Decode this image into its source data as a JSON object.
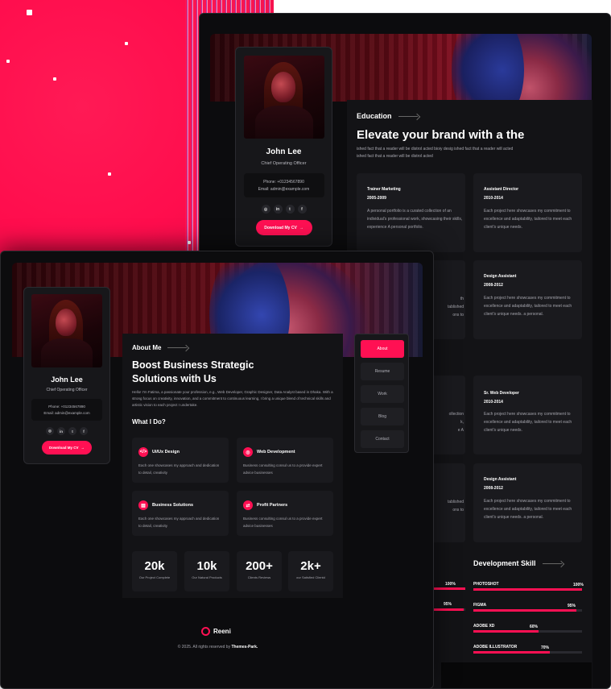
{
  "colors": {
    "accent": "#ff1053",
    "background": "#0c0c0e",
    "card": "#1a1a1e",
    "pink_bg": "#ff1a55"
  },
  "profile": {
    "name": "John Lee",
    "role": "Chief Operating Officer",
    "phone": "Phone: +01234567890",
    "email": "Email: admin@example.com",
    "socials": [
      "instagram-icon",
      "linkedin-icon",
      "twitter-icon",
      "facebook-icon"
    ],
    "social_glyphs": [
      "◎",
      "in",
      "t",
      "f"
    ],
    "cv_button": "Download My CV"
  },
  "resume": {
    "section_label": "Education",
    "headline": "Elevate your brand with a the",
    "intro": "ished fact that a reader will be distrol acted bioiy desig ished fact that a reader will acted ished fact that a reader will be distrol acted",
    "cards": [
      {
        "title": "Trainer Marketing",
        "years": "2005-2009",
        "desc": "A personal portfolio is a curated collection of an individual's professional work, showcasing their skills, experience A personal portfolio."
      },
      {
        "title": "Assistant Director",
        "years": "2010-2014",
        "desc": "Each project here showcases my commitment to excellence and adaptability, tailored to meet each client's unique needs."
      },
      {
        "title": "Design Assistant",
        "years": "2008-2012",
        "desc": "Each project here showcases my commitment to excellence and adaptability, tailored to meet each client's unique needs. a personal."
      },
      {
        "title": "Sr. Web Developer",
        "years": "2010-2014",
        "desc": "Each project here showcases my commitment to excellence and adaptability, tailored to meet each client's unique needs."
      },
      {
        "title": "Design Assistant",
        "years": "2008-2012",
        "desc": "Each project here showcases my commitment to excellence and adaptability, tailored to meet each client's unique needs. a personal."
      }
    ],
    "partial_texts": [
      "th",
      "tablished",
      "ons to",
      "ollection",
      "k,",
      "e A",
      "tablished",
      "ons to"
    ],
    "skills_label": "Development Skill",
    "skills": [
      {
        "name": "PHOTOSHOT",
        "percent": 100
      },
      {
        "name": "FIGMA",
        "percent": 95
      },
      {
        "name": "ADOBE XD",
        "percent": 60
      },
      {
        "name": "ADOBE ILLUSTRATOR",
        "percent": 70
      }
    ],
    "left_skill_pcts": [
      "100%",
      "95%"
    ]
  },
  "about": {
    "section_label": "About Me",
    "headline_line1": "Boost Business Strategic",
    "headline_line2": "Solutions with Us",
    "intro": "Hello! I'm Fatima, a passionate your profession, e.g., Web Developer, Graphic Designer, Data Analyst based in Dhaka. With a strong focus on creativity, innovation, and a commitment to continuous learning, I bring a unique blend of technical skills and artistic vision to each project I undertake.",
    "services_title": "What I Do?",
    "services": [
      {
        "icon": "code-icon",
        "glyph": "</>",
        "title": "Ui/Ux Design",
        "desc": "Each one showcases my approach and dedication to detail, creativity"
      },
      {
        "icon": "globe-icon",
        "glyph": "◎",
        "title": "Web Development",
        "desc": "Business consulting consul us to a provide expert advice businesses"
      },
      {
        "icon": "briefcase-icon",
        "glyph": "▤",
        "title": "Business Solutions",
        "desc": "Each one showcases my approach and dedication to detail, creativity"
      },
      {
        "icon": "handshake-icon",
        "glyph": "⇄",
        "title": "Profit Partners",
        "desc": "Business consulting consul us to a provide expert advice businesses"
      }
    ],
    "stats": [
      {
        "number": "20k",
        "label": "Our Project Complete"
      },
      {
        "number": "10k",
        "label": "Our Natural Products"
      },
      {
        "number": "200+",
        "label": "Clients Reviews"
      },
      {
        "number": "2k+",
        "label": "our Satisfied Clientd"
      }
    ]
  },
  "nav": {
    "items": [
      "About",
      "Resume",
      "Work",
      "Blog",
      "Contact"
    ],
    "active": "About"
  },
  "footer": {
    "brand": "Reeni",
    "copyright_prefix": "© 2025. All rights reserved by ",
    "copyright_owner": "Themes-Park."
  }
}
